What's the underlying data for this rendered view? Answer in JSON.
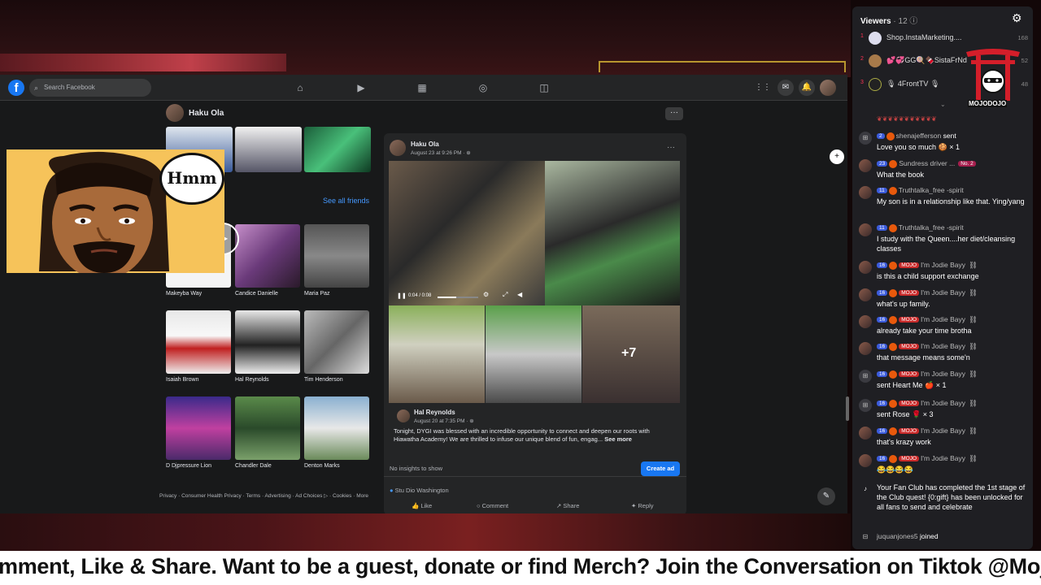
{
  "facebook": {
    "search_placeholder": "Search Facebook",
    "profile_name": "Haku Ola",
    "see_all_friends": "See all friends",
    "friends": [
      {
        "name": "Makeyba Way"
      },
      {
        "name": "Candice Danielle"
      },
      {
        "name": "Maria Paz"
      },
      {
        "name": "Isaiah Brown"
      },
      {
        "name": "Hal Reynolds"
      },
      {
        "name": "Tim Henderson"
      },
      {
        "name": "D Djpressure Lion"
      },
      {
        "name": "Chandler Dale"
      },
      {
        "name": "Denton Marks"
      }
    ],
    "footer_links": "Privacy · Consumer Health Privacy · Terms · Advertising · Ad Choices ▷ · Cookies · More",
    "post": {
      "author": "Haku Ola",
      "date": "August 23 at 9:26 PM · ⊕",
      "video_time": "0:04 / 0:08",
      "more_count": "+7",
      "shared_author": "Hal Reynolds",
      "shared_date": "August 20 at 7:35 PM · ⊕",
      "caption": "Tonight, DYGI was blessed with an incredible opportunity to connect and deepen our roots with Hiawatha Academy! We are thrilled to infuse our unique blend of fun, engag...",
      "see_more": "See more",
      "insights": "No insights to show",
      "create_ad": "Create ad",
      "reaction_name": "Stu Dio Washington",
      "actions": [
        "Like",
        "Comment",
        "Share",
        "Reply"
      ]
    }
  },
  "meme": {
    "bubble_text": "Hmm"
  },
  "viewers": {
    "title": "Viewers",
    "count": "· 12",
    "list": [
      {
        "rank": "1",
        "name": "Shop.InstaMarketing....",
        "score": "168"
      },
      {
        "rank": "2",
        "name": "💕💞GG🍭🍫SistaFrNd",
        "score": "52"
      },
      {
        "rank": "3",
        "name": "🎙 4FrontTV 🎙",
        "score": "48"
      }
    ],
    "logo_text": "MOJODOJO"
  },
  "chat": [
    {
      "icon": "gift",
      "level": "2",
      "user": "shenajefferson",
      "action": "sent",
      "text": "Love you so much 🍪 × 1"
    },
    {
      "icon": "avatar",
      "level": "23",
      "user": "Sundress driver ...",
      "rank_badge": "No. 2",
      "text": "What the book"
    },
    {
      "icon": "avatar",
      "level": "11",
      "user": "Truthtalka_free -spirit",
      "text": "My son is in a relationship like that. Ying/yang"
    },
    {
      "icon": "avatar",
      "level": "11",
      "user": "Truthtalka_free -spirit",
      "text": "I study with the Queen....her diet/cleansing classes"
    },
    {
      "icon": "avatar",
      "level": "16",
      "club": "MOJO",
      "user": "I'm Jodie Bayy",
      "text": "is this a child support exchange"
    },
    {
      "icon": "avatar",
      "level": "16",
      "club": "MOJO",
      "user": "I'm Jodie Bayy",
      "text": "what's up family."
    },
    {
      "icon": "avatar",
      "level": "16",
      "club": "MOJO",
      "user": "I'm Jodie Bayy",
      "text": "already take your time brotha"
    },
    {
      "icon": "avatar",
      "level": "16",
      "club": "MOJO",
      "user": "I'm Jodie Bayy",
      "text": "that message means some'n"
    },
    {
      "icon": "gift",
      "level": "16",
      "club": "MOJO",
      "user": "I'm Jodie Bayy",
      "text": "sent Heart Me 🍎 × 1"
    },
    {
      "icon": "gift",
      "level": "16",
      "club": "MOJO",
      "user": "I'm Jodie Bayy",
      "text": "sent Rose 🌹 × 3"
    },
    {
      "icon": "avatar",
      "level": "16",
      "club": "MOJO",
      "user": "I'm Jodie Bayy",
      "text": "that's krazy work"
    },
    {
      "icon": "avatar",
      "level": "16",
      "club": "MOJO",
      "user": "I'm Jodie Bayy",
      "text": "😂😂😂😂"
    }
  ],
  "fan_club_notice": "Your Fan Club has completed the 1st stage of the Club quest! {0:gift} has been unlocked for all fans to send and celebrate",
  "joined": {
    "user": "juquanjones5",
    "text": "joined"
  },
  "ticker_text": "mment, Like & Share. Want to be a guest, donate or find Merch? Join the Conversation on Tiktok @MojoD"
}
